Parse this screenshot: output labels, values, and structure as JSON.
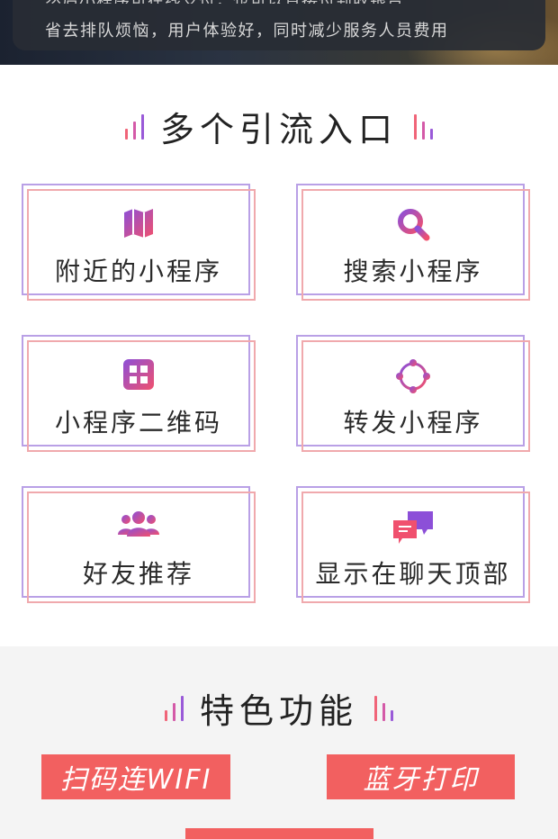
{
  "banner": {
    "line1_partial": "然后小程序可在线支付，也可以直接付到收银台",
    "line2": "省去排队烦恼，用户体验好，同时减少服务人员费用"
  },
  "entries": {
    "title": "多个引流入口",
    "items": [
      {
        "label": "附近的小程序",
        "icon": "map-icon"
      },
      {
        "label": "搜索小程序",
        "icon": "search-icon"
      },
      {
        "label": "小程序二维码",
        "icon": "grid-icon"
      },
      {
        "label": "转发小程序",
        "icon": "share-network-icon"
      },
      {
        "label": "好友推荐",
        "icon": "users-icon"
      },
      {
        "label": "显示在聊天顶部",
        "icon": "chat-bubbles-icon"
      }
    ]
  },
  "features": {
    "title": "特色功能",
    "buttons": [
      {
        "label": "扫码连WIFI"
      },
      {
        "label": "蓝牙打印"
      }
    ]
  },
  "colors": {
    "accent_purple": "#8c4fd8",
    "accent_pink": "#f0506e",
    "pill_red": "#f26060"
  }
}
